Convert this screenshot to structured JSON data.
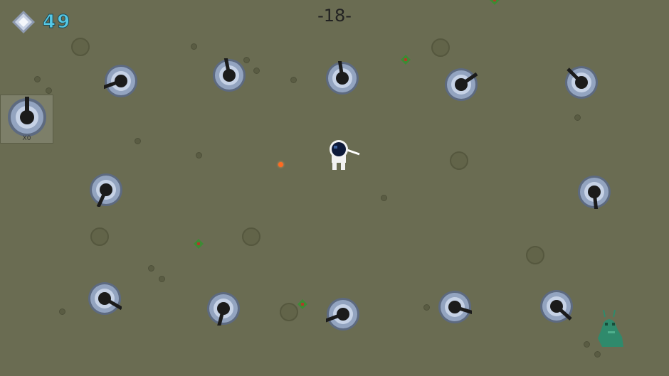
{
  "hud": {
    "gem_count": "49",
    "gem_icon": "diamond-gem-icon",
    "wave_label": "-18-"
  },
  "build_slot": {
    "icon": "turret-icon",
    "count_label": "X0"
  },
  "colors": {
    "ground": "#6a6c52",
    "gem_text": "#55c8e6",
    "turret_ring": "#8fa0bc",
    "pickup": "#3d8a35",
    "enemy": "#2f8a6c",
    "projectile": "#ff6a20"
  }
}
